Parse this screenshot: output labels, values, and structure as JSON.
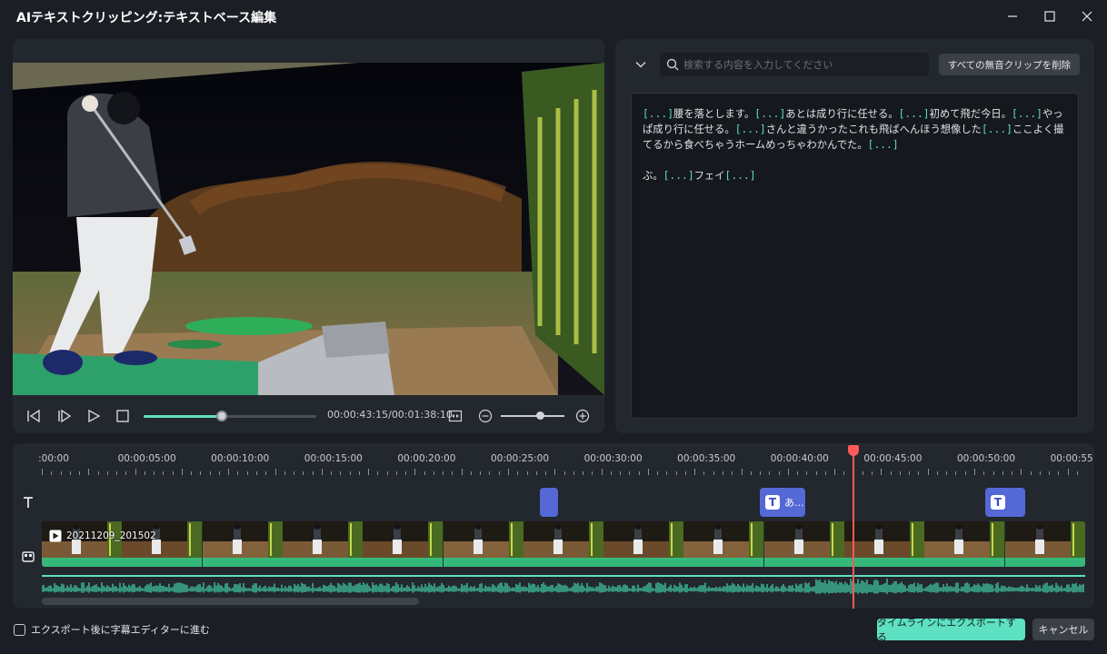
{
  "window": {
    "title": "AIテキストクリッピング:テキストベース編集"
  },
  "player": {
    "timecode": "00:00:43:15/00:01:38:10",
    "progress": 0.45,
    "zoom_level": 0.62
  },
  "transcript": {
    "search_placeholder": "検索する内容を入力してください",
    "delete_silence_label": "すべての無音クリップを削除",
    "paragraphs": [
      [
        {
          "t": "[...]",
          "hl": true
        },
        {
          "t": "腰を落とします。",
          "hl": false
        },
        {
          "t": "[...]",
          "hl": true
        },
        {
          "t": "あとは成り行に任せる。",
          "hl": false
        },
        {
          "t": "[...]",
          "hl": true
        },
        {
          "t": "初めて飛だ今日。",
          "hl": false
        },
        {
          "t": "[...]",
          "hl": true
        },
        {
          "t": "やっぱ成り行に任せる。",
          "hl": false
        },
        {
          "t": "[...]",
          "hl": true
        },
        {
          "t": "さんと違うかったこれも飛ばへんほう想像した",
          "hl": false
        },
        {
          "t": "[...]",
          "hl": true
        },
        {
          "t": "ここよく撮てるから食べちゃうホームめっちゃわかんでた。",
          "hl": false
        },
        {
          "t": "[...]",
          "hl": true
        }
      ],
      [
        {
          "t": "ぶ。",
          "hl": false
        },
        {
          "t": "[...]",
          "hl": true
        },
        {
          "t": "フェイ",
          "hl": false
        },
        {
          "t": "[...]",
          "hl": true
        }
      ]
    ]
  },
  "timeline": {
    "ruler_labels": [
      ":00:00",
      "00:00:05:00",
      "00:00:10:00",
      "00:00:15:00",
      "00:00:20:00",
      "00:00:25:00",
      "00:00:30:00",
      "00:00:35:00",
      "00:00:40:00",
      "00:00:45:00",
      "00:00:50:00",
      "00:00:55:00"
    ],
    "text_clips": [
      {
        "label": ""
      },
      {
        "label": "あ..."
      },
      {
        "label": ""
      }
    ],
    "video_clip_name": "20211209_201502",
    "playhead_time": "00:00:43:15"
  },
  "footer": {
    "checkbox_label": "エクスポート後に字幕エディターに進む",
    "export_label": "タイムラインにエクスポートする",
    "cancel_label": "キャンセル"
  },
  "colors": {
    "accent": "#5ee0c2",
    "playhead": "#ff5a5a",
    "text_clip": "#5468d6",
    "panel": "#23272e",
    "background": "#1b1e24"
  }
}
